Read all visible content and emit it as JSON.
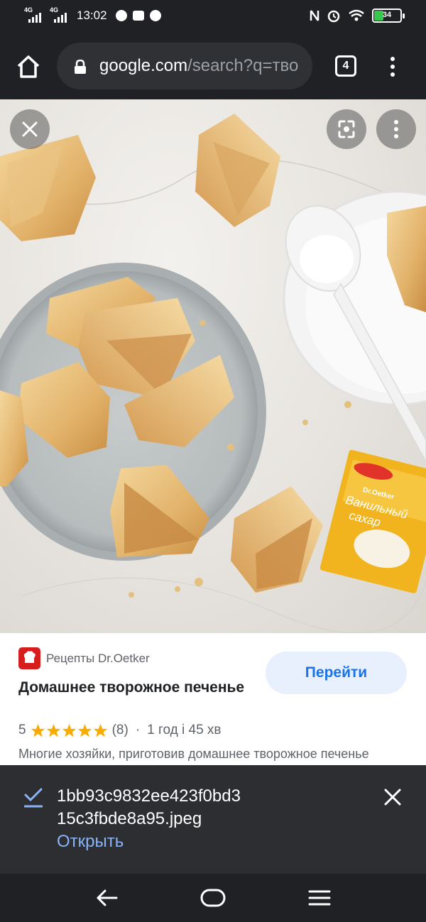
{
  "status_bar": {
    "signal1_label": "4G",
    "signal2_label": "4G",
    "time": "13:02",
    "battery_level": "34"
  },
  "toolbar": {
    "url_domain": "google.com",
    "url_path": "/search?q=тво",
    "tab_count": "4",
    "icons": [
      "home-icon",
      "lock-icon",
      "tabs-icon",
      "more-vert-icon"
    ]
  },
  "image_view": {
    "close_icon": "close-icon",
    "lens_icon": "lens-icon",
    "more_icon": "more-vert-icon",
    "packet_brand": "Dr.Oetker",
    "packet_text_line1": "Ванильный",
    "packet_text_line2": "сахар"
  },
  "result": {
    "source_name": "Рецепты Dr.Oetker",
    "title": "Домашнее творожное печенье",
    "rating": "5",
    "review_count": "(8)",
    "separator": "·",
    "duration": "1 год і 45 хв",
    "description": "Многие хозяйки, приготовив домашнее творожное печенье",
    "go_button_label": "Перейти"
  },
  "download_bar": {
    "file_name": "1bb93c9832ee423f0bd315c3fbde8a95.jpeg",
    "open_label": "Открыть"
  },
  "colors": {
    "accent": "#1a73e8",
    "link": "#8ab4f8",
    "star": "#f9ab00",
    "brand_red": "#d61e1e"
  }
}
